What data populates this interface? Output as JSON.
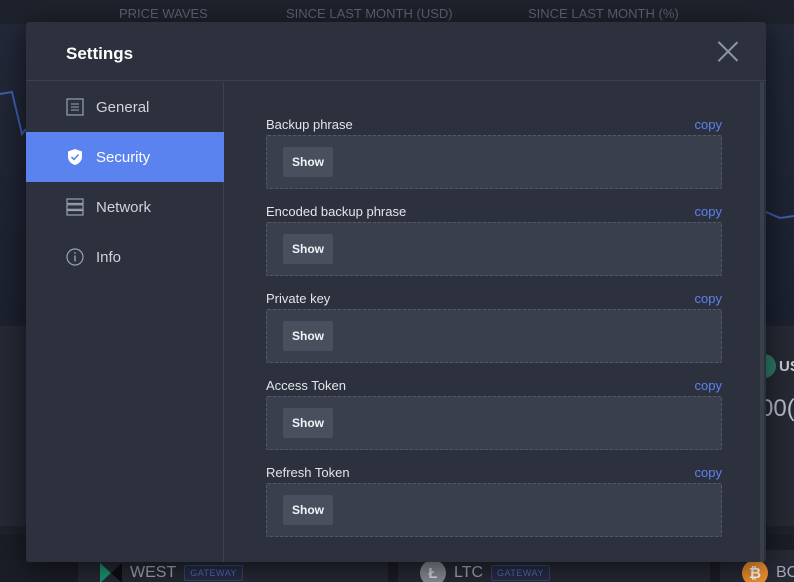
{
  "background": {
    "header_labels": [
      "PRICE WAVES",
      "SINCE LAST MONTH (USD)",
      "SINCE LAST MONTH (%)"
    ],
    "coins": [
      {
        "name": "WEST",
        "badge": "GATEWAY"
      },
      {
        "name": "LTC",
        "badge": "GATEWAY"
      },
      {
        "name": "BC"
      }
    ],
    "right_ticker": "US",
    "right_value": "00("
  },
  "modal": {
    "title": "Settings"
  },
  "sidebar": {
    "items": [
      {
        "label": "General",
        "icon": "list-icon",
        "active": false
      },
      {
        "label": "Security",
        "icon": "shield-icon",
        "active": true
      },
      {
        "label": "Network",
        "icon": "server-icon",
        "active": false
      },
      {
        "label": "Info",
        "icon": "info-icon",
        "active": false
      }
    ]
  },
  "security": {
    "fields": [
      {
        "label": "Backup phrase",
        "copy": "copy",
        "button": "Show"
      },
      {
        "label": "Encoded backup phrase",
        "copy": "copy",
        "button": "Show"
      },
      {
        "label": "Private key",
        "copy": "copy",
        "button": "Show"
      },
      {
        "label": "Access Token",
        "copy": "copy",
        "button": "Show"
      },
      {
        "label": "Refresh Token",
        "copy": "copy",
        "button": "Show"
      }
    ]
  },
  "colors": {
    "accent": "#5a83ef",
    "modal_bg": "#2d313d",
    "field_bg": "#3a3f4d"
  }
}
